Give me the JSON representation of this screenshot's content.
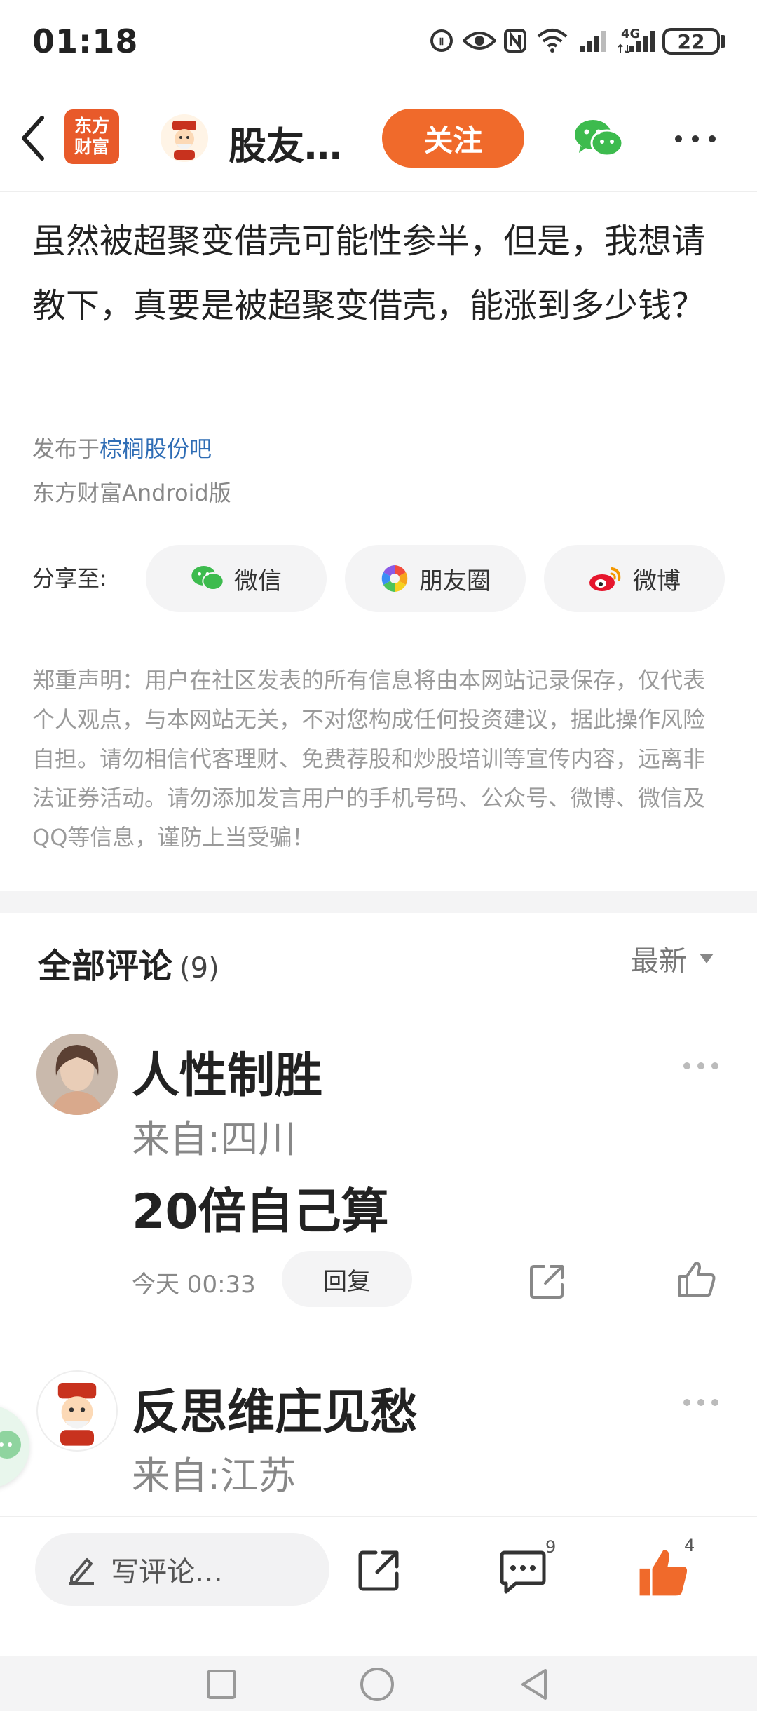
{
  "status_bar": {
    "time": "01:18",
    "battery": "22",
    "network": "4G"
  },
  "header": {
    "logo_line1": "东方",
    "logo_line2": "财富",
    "title": "股友…",
    "follow_label": "关注"
  },
  "post": {
    "body": "虽然被超聚变借壳可能性参半，但是，我想请教下，真要是被超聚变借壳，能涨到多少钱？",
    "published_prefix": "发布于",
    "forum_name": "棕榈股份吧",
    "client": "东方财富Android版"
  },
  "share": {
    "label": "分享至:",
    "options": [
      {
        "label": "微信",
        "icon": "wechat-icon"
      },
      {
        "label": "朋友圈",
        "icon": "moments-icon"
      },
      {
        "label": "微博",
        "icon": "weibo-icon"
      }
    ]
  },
  "disclaimer": "郑重声明：用户在社区发表的所有信息将由本网站记录保存，仅代表个人观点，与本网站无关，不对您构成任何投资建议，据此操作风险自担。请勿相信代客理财、免费荐股和炒股培训等宣传内容，远离非法证券活动。请勿添加发言用户的手机号码、公众号、微博、微信及QQ等信息，谨防上当受骗！",
  "comments_section": {
    "title": "全部评论",
    "count": "(9)",
    "sort": "最新",
    "comments": [
      {
        "name": "人性制胜",
        "location": "来自:四川",
        "text": "20倍自己算",
        "time": "今天 00:33",
        "reply_label": "回复"
      },
      {
        "name": "反思维庄见愁",
        "location": "来自:江苏"
      }
    ]
  },
  "bottom_bar": {
    "comment_placeholder": "写评论…",
    "comment_badge": "9",
    "like_badge": "4"
  },
  "colors": {
    "accent": "#f06a2b",
    "link": "#2f6db5",
    "wechat_green": "#3dbb4e"
  }
}
